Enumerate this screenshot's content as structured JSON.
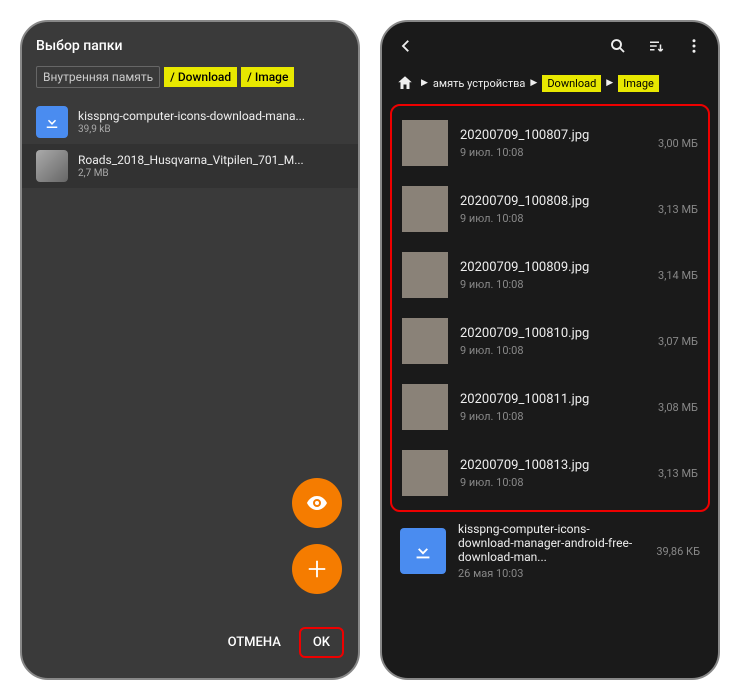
{
  "left": {
    "title": "Выбор папки",
    "breadcrumb": {
      "root": "Внутренняя память",
      "p1": "/ Download",
      "p2": "/ Image"
    },
    "files": [
      {
        "name": "kisspng-computer-icons-download-mana...",
        "size": "39,9 kB",
        "thumb": "download"
      },
      {
        "name": "Roads_2018_Husqvarna_Vitpilen_701_M...",
        "size": "2,7 MB",
        "thumb": "image"
      }
    ],
    "cancel": "ОТМЕНА",
    "ok": "OK"
  },
  "right": {
    "breadcrumb": {
      "root": "амять устройства",
      "p1": "Download",
      "p2": "Image"
    },
    "files": [
      {
        "name": "20200709_100807.jpg",
        "date": "9 июл. 10:08",
        "size": "3,00 МБ"
      },
      {
        "name": "20200709_100808.jpg",
        "date": "9 июл. 10:08",
        "size": "3,13 МБ"
      },
      {
        "name": "20200709_100809.jpg",
        "date": "9 июл. 10:08",
        "size": "3,14 МБ"
      },
      {
        "name": "20200709_100810.jpg",
        "date": "9 июл. 10:08",
        "size": "3,07 МБ"
      },
      {
        "name": "20200709_100811.jpg",
        "date": "9 июл. 10:08",
        "size": "3,08 МБ"
      },
      {
        "name": "20200709_100813.jpg",
        "date": "9 июл. 10:08",
        "size": "3,13 МБ"
      }
    ],
    "bottom": {
      "name": "kisspng-computer-icons-download-manager-android-free-download-man...",
      "date": "26 мая 10:03",
      "size": "39,86 КБ"
    }
  }
}
